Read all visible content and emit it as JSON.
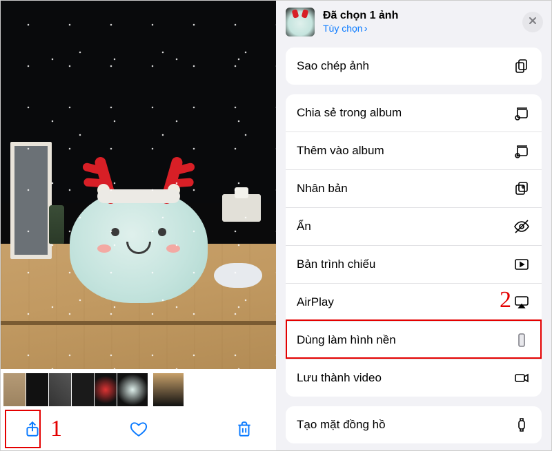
{
  "left": {
    "toolbar": {
      "share": "share",
      "favorite": "favorite",
      "trash": "trash"
    }
  },
  "annotations": {
    "num1": "1",
    "num2": "2"
  },
  "sheet": {
    "header": {
      "title": "Đã chọn 1 ảnh",
      "subtitle": "Tùy chọn",
      "close": "×"
    },
    "groups": [
      {
        "rows": [
          {
            "label": "Sao chép ảnh",
            "icon": "copy-photo"
          }
        ]
      },
      {
        "rows": [
          {
            "label": "Chia sẻ trong album",
            "icon": "shared-album"
          },
          {
            "label": "Thêm vào album",
            "icon": "add-album"
          },
          {
            "label": "Nhân bản",
            "icon": "duplicate"
          },
          {
            "label": "Ẩn",
            "icon": "hide"
          },
          {
            "label": "Bản trình chiếu",
            "icon": "slideshow"
          },
          {
            "label": "AirPlay",
            "icon": "airplay"
          },
          {
            "label": "Dùng làm hình nền",
            "icon": "wallpaper",
            "highlight": true
          },
          {
            "label": "Lưu thành video",
            "icon": "save-video"
          }
        ]
      },
      {
        "rows": [
          {
            "label": "Tạo mặt đồng hồ",
            "icon": "watch-face"
          }
        ]
      }
    ]
  }
}
